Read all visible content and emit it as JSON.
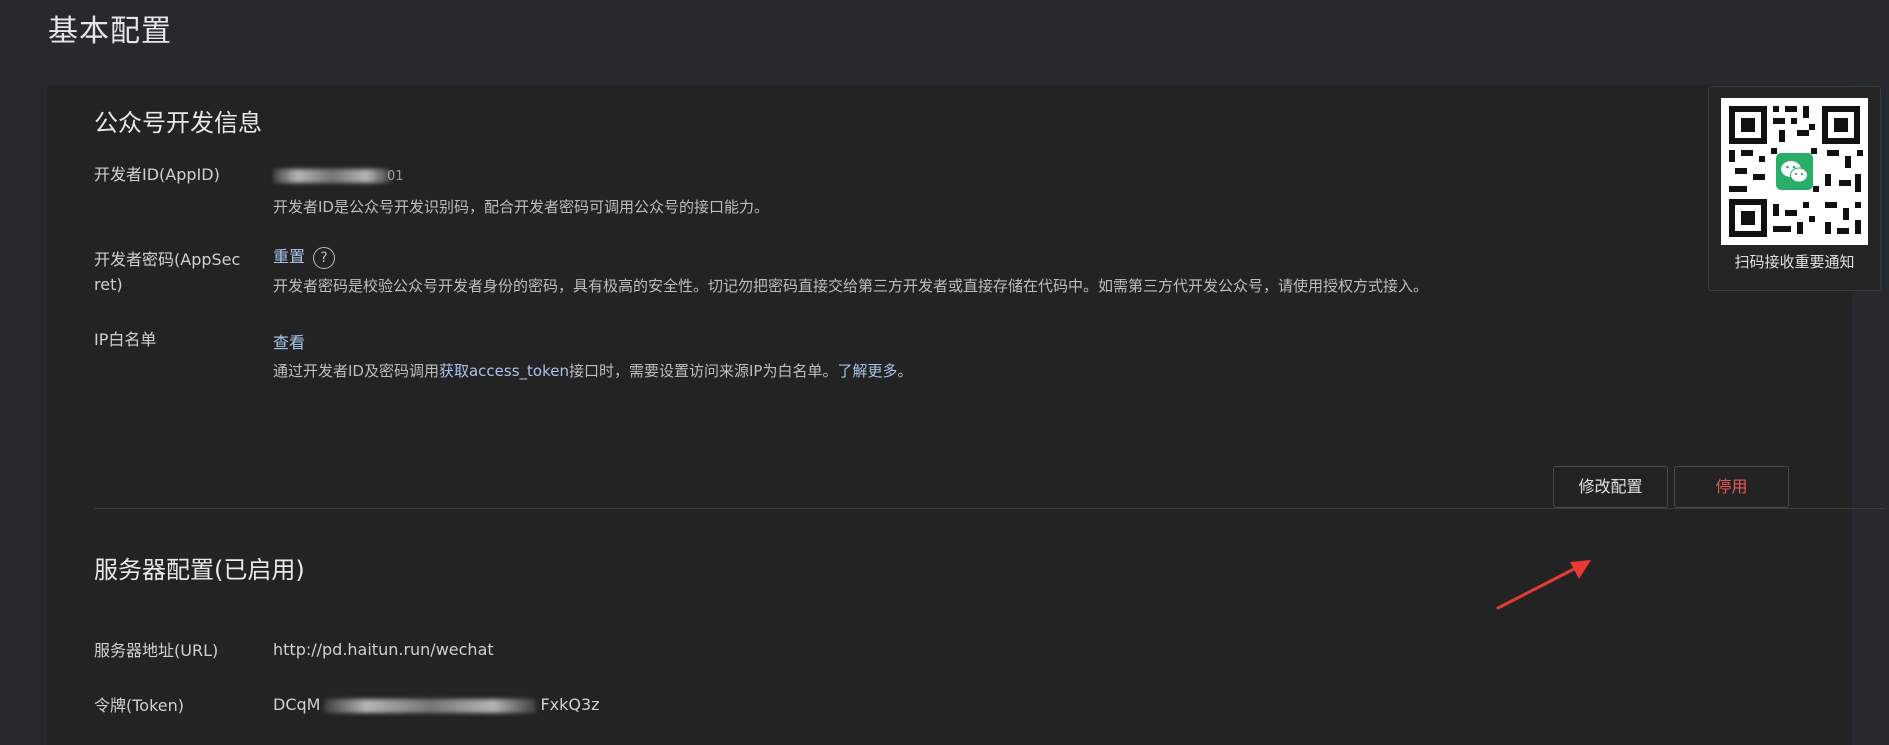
{
  "page": {
    "title": "基本配置"
  },
  "dev_info": {
    "title": "公众号开发信息",
    "appid": {
      "label": "开发者ID(AppID)",
      "value_tail": "01",
      "desc": "开发者ID是公众号开发识别码，配合开发者密码可调用公众号的接口能力。"
    },
    "appsecret": {
      "label_line1": "开发者密码(AppSec",
      "label_line2": "ret)",
      "reset": "重置",
      "help_glyph": "?",
      "desc": "开发者密码是校验公众号开发者身份的密码，具有极高的安全性。切记勿把密码直接交给第三方开发者或直接存储在代码中。如需第三方代开发公众号，请使用授权方式接入。"
    },
    "ip_whitelist": {
      "label": "IP白名单",
      "view": "查看",
      "desc_prefix": "通过开发者ID及密码调用",
      "desc_link": "获取access_token",
      "desc_middle": "接口时，需要设置访问来源IP为白名单。",
      "desc_more": "了解更多",
      "desc_suffix": "。"
    }
  },
  "server_config": {
    "title": "服务器配置(已启用)",
    "modify_button": "修改配置",
    "disable_button": "停用",
    "url": {
      "label": "服务器地址(URL)",
      "value": "http://pd.haitun.run/wechat"
    },
    "token": {
      "label": "令牌(Token)",
      "value_head": "DCqM",
      "value_tail": "FxkQ3z"
    }
  },
  "qr_panel": {
    "caption": "扫码接收重要通知",
    "icon": "wechat-icon"
  },
  "colors": {
    "link": "#a9c4ec",
    "danger": "#e45a5a",
    "annotation_arrow": "#e83a35"
  }
}
